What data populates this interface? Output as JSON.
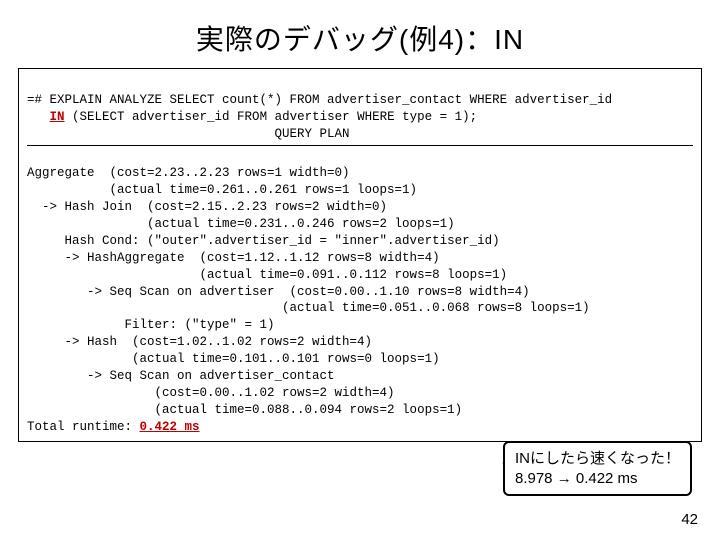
{
  "title": "実際のデバッグ(例4)：IN",
  "sql_line1": "=# EXPLAIN ANALYZE SELECT count(*) FROM advertiser_contact WHERE advertiser_id",
  "sql_in": "IN",
  "sql_line2": " (SELECT advertiser_id FROM advertiser WHERE type = 1);",
  "query_plan_header": "                                 QUERY PLAN",
  "plan": [
    "Aggregate  (cost=2.23..2.23 rows=1 width=0)",
    "           (actual time=0.261..0.261 rows=1 loops=1)",
    "  -> Hash Join  (cost=2.15..2.23 rows=2 width=0)",
    "                (actual time=0.231..0.246 rows=2 loops=1)",
    "     Hash Cond: (\"outer\".advertiser_id = \"inner\".advertiser_id)",
    "     -> HashAggregate  (cost=1.12..1.12 rows=8 width=4)",
    "                       (actual time=0.091..0.112 rows=8 loops=1)",
    "        -> Seq Scan on advertiser  (cost=0.00..1.10 rows=8 width=4)",
    "                                  (actual time=0.051..0.068 rows=8 loops=1)",
    "             Filter: (\"type\" = 1)",
    "     -> Hash  (cost=1.02..1.02 rows=2 width=4)",
    "              (actual time=0.101..0.101 rows=0 loops=1)",
    "        -> Seq Scan on advertiser_contact",
    "                 (cost=0.00..1.02 rows=2 width=4)",
    "                 (actual time=0.088..0.094 rows=2 loops=1)"
  ],
  "runtime_label": "Total runtime: ",
  "runtime_value": "0.422 ms",
  "callout_line1": "INにしたら速くなった！",
  "callout_line2": "8.978 → 0.422 ms",
  "page_number": "42"
}
